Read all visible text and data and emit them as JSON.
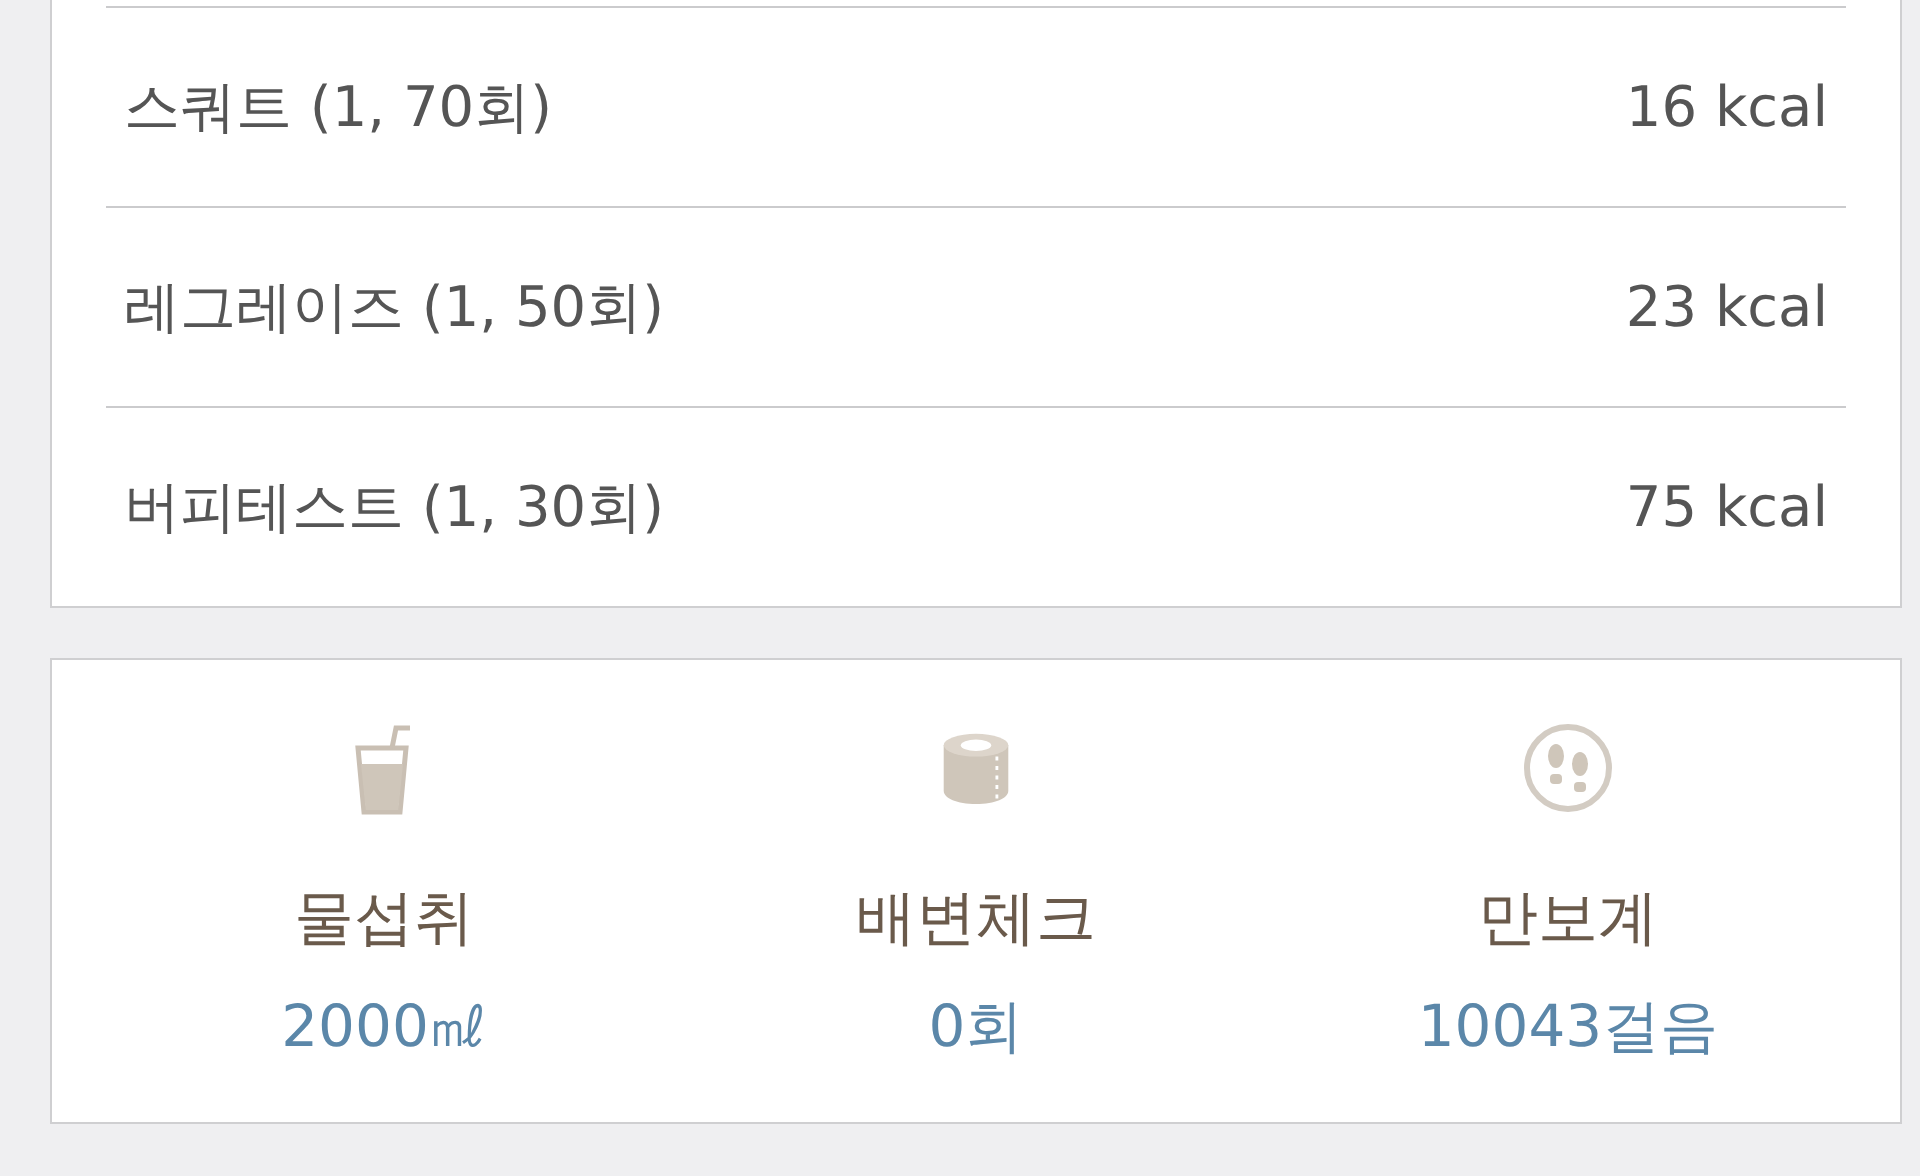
{
  "exercises": [
    {
      "name": "스쿼트 (1, 70회)",
      "calories": "16 kcal"
    },
    {
      "name": "레그레이즈 (1, 50회)",
      "calories": "23 kcal"
    },
    {
      "name": "버피테스트 (1, 30회)",
      "calories": "75 kcal"
    }
  ],
  "stats": [
    {
      "kind": "water",
      "label": "물섭취",
      "value": "2000㎖"
    },
    {
      "kind": "toilet",
      "label": "배변체크",
      "value": "0회"
    },
    {
      "kind": "steps",
      "label": "만보계",
      "value": "10043걸음"
    }
  ]
}
